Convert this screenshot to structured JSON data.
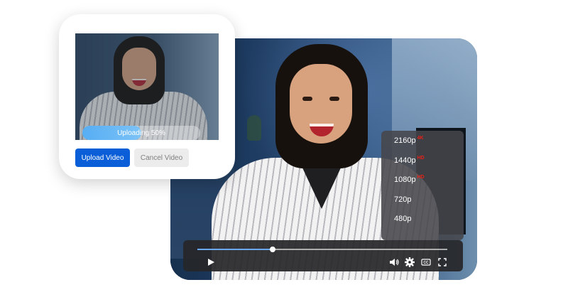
{
  "upload_card": {
    "progress_text": "Uploading 50%",
    "progress_fraction": 0.5,
    "upload_button": "Upload Video",
    "cancel_button": "Cancel Video"
  },
  "player": {
    "quality_options": [
      {
        "label": "2160p",
        "badge": "4K"
      },
      {
        "label": "1440p",
        "badge": "HD"
      },
      {
        "label": "1080p",
        "badge": "HD"
      },
      {
        "label": "720p",
        "badge": ""
      },
      {
        "label": "480p",
        "badge": ""
      }
    ],
    "seek_fraction": 0.3,
    "controls": {
      "play_icon": "play-icon",
      "volume_icon": "volume-icon",
      "settings_icon": "gear-icon",
      "captions_icon": "captions-icon",
      "fullscreen_icon": "fullscreen-icon"
    }
  },
  "colors": {
    "accent_blue": "#0a5ed7",
    "progress_blue": "#56aef3",
    "seek_blue": "#6aa9ff",
    "badge_red": "#e62117"
  }
}
